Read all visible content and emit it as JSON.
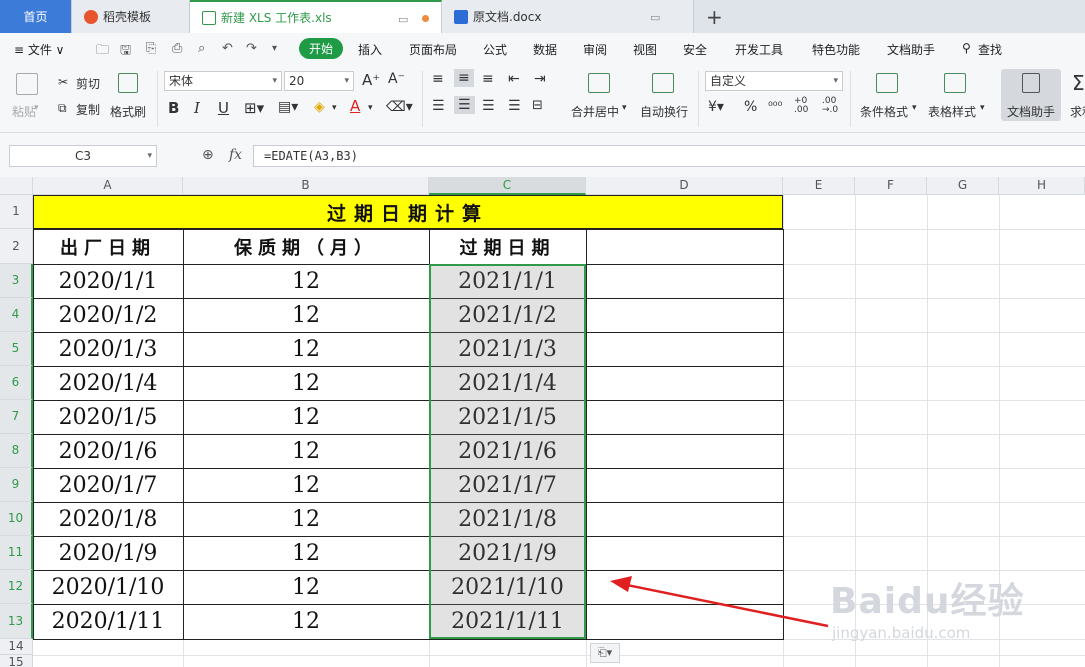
{
  "tabs": {
    "home": "首页",
    "t1": "稻壳模板",
    "t2": "新建 XLS 工作表.xls",
    "t3": "原文档.docx",
    "new_tab": "+"
  },
  "menu": {
    "file": "≡ 文件 ∨",
    "start": "开始",
    "items": [
      "插入",
      "页面布局",
      "公式",
      "数据",
      "审阅",
      "视图",
      "安全",
      "开发工具",
      "特色功能",
      "文档助手"
    ],
    "search": "查找"
  },
  "ribbon": {
    "paste": "粘贴",
    "cut": "剪切",
    "copy": "复制",
    "format_painter": "格式刷",
    "font_name": "宋体",
    "font_size": "20",
    "merge_center": "合并居中",
    "wrap_text": "自动换行",
    "number_format": "自定义",
    "cond_format": "条件格式",
    "table_style": "表格样式",
    "doc_assistant": "文档助手",
    "sum": "求和"
  },
  "formula_bar": {
    "name_box": "C3",
    "fx": "fx",
    "formula": "=EDATE(A3,B3)"
  },
  "sheet": {
    "columns": [
      "A",
      "B",
      "C",
      "D",
      "E",
      "F",
      "G",
      "H"
    ],
    "rows": [
      "1",
      "2",
      "3",
      "4",
      "5",
      "6",
      "7",
      "8",
      "9",
      "10",
      "11",
      "12",
      "13",
      "14",
      "15"
    ],
    "title": "过期日期计算",
    "headers": [
      "出厂日期",
      "保质期（月）",
      "过期日期"
    ],
    "data": [
      [
        "2020/1/1",
        "12",
        "2021/1/1"
      ],
      [
        "2020/1/2",
        "12",
        "2021/1/2"
      ],
      [
        "2020/1/3",
        "12",
        "2021/1/3"
      ],
      [
        "2020/1/4",
        "12",
        "2021/1/4"
      ],
      [
        "2020/1/5",
        "12",
        "2021/1/5"
      ],
      [
        "2020/1/6",
        "12",
        "2021/1/6"
      ],
      [
        "2020/1/7",
        "12",
        "2021/1/7"
      ],
      [
        "2020/1/8",
        "12",
        "2021/1/8"
      ],
      [
        "2020/1/9",
        "12",
        "2021/1/9"
      ],
      [
        "2020/1/10",
        "12",
        "2021/1/10"
      ],
      [
        "2020/1/11",
        "12",
        "2021/1/11"
      ]
    ],
    "selected_column": "C",
    "selected_rows": [
      "3",
      "4",
      "5",
      "6",
      "7",
      "8",
      "9",
      "10",
      "11",
      "12",
      "13"
    ]
  },
  "watermark": {
    "brand": "Baidu经验",
    "url": "jingyan.baidu.com"
  },
  "colors": {
    "accent_green": "#2f9a4a",
    "title_fill": "#ffff00",
    "arrow_red": "#e02020"
  }
}
